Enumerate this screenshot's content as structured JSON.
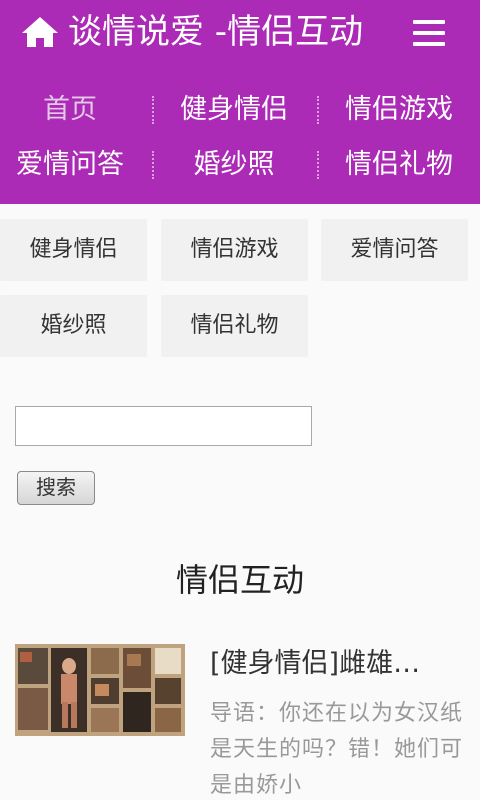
{
  "header": {
    "title": "谈情说爱 -情侣互动",
    "home_icon": "home-icon",
    "menu_icon": "menu-icon",
    "background": "#ab2ab6"
  },
  "nav": {
    "items": [
      {
        "label": "首页",
        "active": true
      },
      {
        "label": "健身情侣"
      },
      {
        "label": "情侣游戏"
      },
      {
        "label": "爱情问答"
      },
      {
        "label": "婚纱照"
      },
      {
        "label": "情侣礼物"
      }
    ]
  },
  "tags": [
    "健身情侣",
    "情侣游戏",
    "爱情问答",
    "婚纱照",
    "情侣礼物"
  ],
  "search": {
    "value": "",
    "placeholder": "",
    "button_label": "搜索"
  },
  "section": {
    "title": "情侣互动"
  },
  "articles": [
    {
      "title": "[健身情侣]雌雄…",
      "summary": "导语：你还在以为女汉纸是天生的吗？错！她们可是由娇小"
    }
  ]
}
